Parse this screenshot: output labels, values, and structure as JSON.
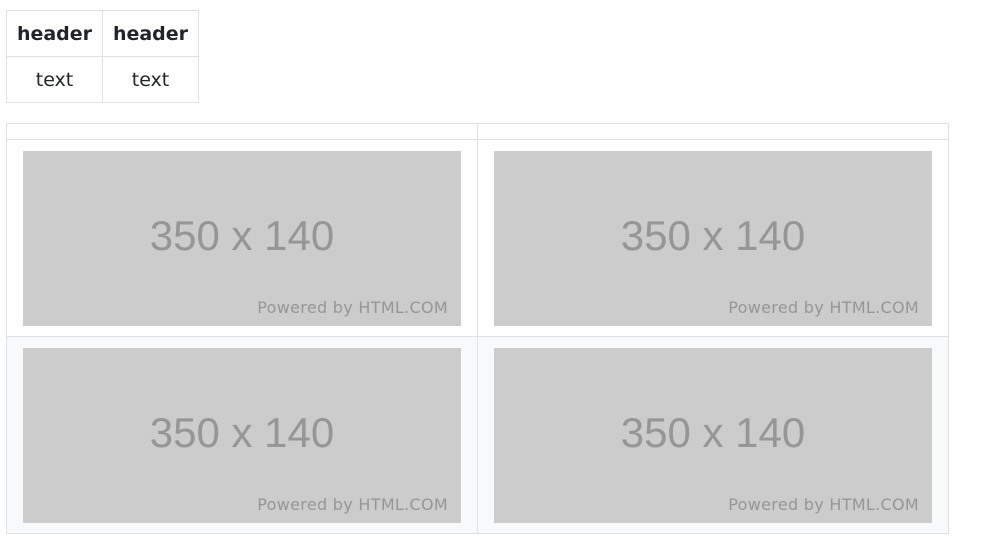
{
  "small_table": {
    "headers": [
      "header",
      "header"
    ],
    "cells": [
      "text",
      "text"
    ]
  },
  "grid_table": {
    "rows": [
      [
        {
          "dims": "350 x 140",
          "powered": "Powered by HTML.COM"
        },
        {
          "dims": "350 x 140",
          "powered": "Powered by HTML.COM"
        }
      ],
      [
        {
          "dims": "350 x 140",
          "powered": "Powered by HTML.COM"
        },
        {
          "dims": "350 x 140",
          "powered": "Powered by HTML.COM"
        }
      ]
    ]
  },
  "colors": {
    "border": "#dee2e6",
    "placeholder_bg": "#cccccc",
    "placeholder_text": "#969696",
    "stripe_bg": "#f8f9fa"
  }
}
